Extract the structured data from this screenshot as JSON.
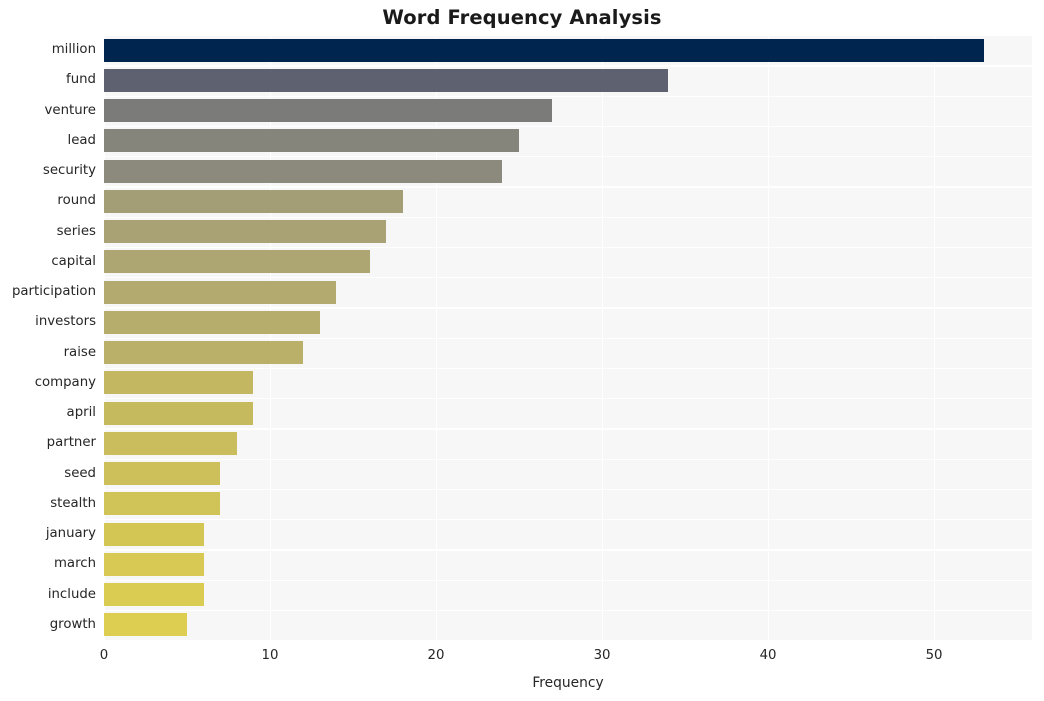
{
  "chart_data": {
    "type": "bar",
    "orientation": "horizontal",
    "title": "Word Frequency Analysis",
    "xlabel": "Frequency",
    "ylabel": "",
    "categories": [
      "million",
      "fund",
      "venture",
      "lead",
      "security",
      "round",
      "series",
      "capital",
      "participation",
      "investors",
      "raise",
      "company",
      "april",
      "partner",
      "seed",
      "stealth",
      "january",
      "march",
      "include",
      "growth"
    ],
    "values": [
      53,
      34,
      27,
      25,
      24,
      18,
      17,
      16,
      14,
      13,
      12,
      9,
      9,
      8,
      7,
      7,
      6,
      6,
      6,
      5
    ],
    "bar_colors": [
      "#00264f",
      "#5d6170",
      "#7b7b79",
      "#85857b",
      "#8b8a7c",
      "#a39e75",
      "#a9a274",
      "#ada572",
      "#b2aa6e",
      "#b6ad6c",
      "#bab069",
      "#c3b861",
      "#c6ba5f",
      "#cabd5d",
      "#cdc05a",
      "#d0c358",
      "#d4c655",
      "#d7c954",
      "#dacb53",
      "#ddce52"
    ],
    "xlim": [
      0,
      55.9
    ],
    "ylim_categories": 20,
    "xticks": [
      0,
      10,
      20,
      30,
      40,
      50
    ],
    "xtick_labels": [
      "0",
      "10",
      "20",
      "30",
      "40",
      "50"
    ],
    "grid": true,
    "grid_color": "#ffffff",
    "plot_background": "#f7f7f7",
    "figure_background": "#ffffff",
    "legend": null,
    "legend_position": "none"
  }
}
